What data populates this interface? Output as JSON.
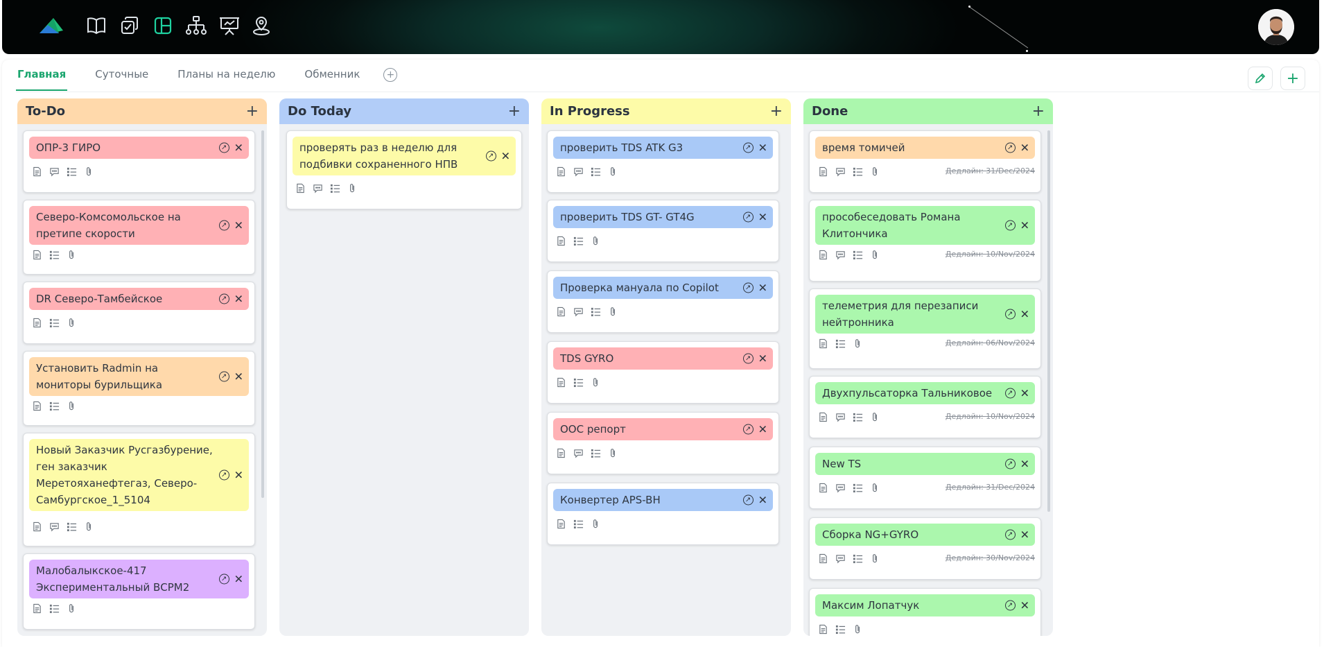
{
  "tabs": [
    "Главная",
    "Суточные",
    "Планы на неделю",
    "Обменник"
  ],
  "nav_icons": [
    "book-icon",
    "tasks-icon",
    "board-icon",
    "structure-icon",
    "presentation-icon",
    "location-icon"
  ],
  "columns": [
    {
      "title": "To-Do",
      "cards": [
        {
          "text": "ОПР-3 ГИРО",
          "color": "#ffb1b5",
          "icons": [
            "doc",
            "comment",
            "list",
            "clip"
          ]
        },
        {
          "text": "Северо-Комсомольское на претипе скорости",
          "color": "#ffb1b5",
          "icons": [
            "doc",
            "list",
            "clip"
          ]
        },
        {
          "text": "DR Северо-Тамбейское",
          "color": "#ffb1b5",
          "icons": [
            "doc",
            "list",
            "clip"
          ]
        },
        {
          "text": "Установить Radmin на мониторы бурильщика",
          "color": "#ffd9ab",
          "icons": [
            "doc",
            "list",
            "clip"
          ]
        },
        {
          "text": "Новый Заказчик Русгазбурение, ген заказчик Меретояханефтегаз, Северо-Самбургское_1_5104",
          "color": "#fdfba8",
          "icons": [
            "doc",
            "comment",
            "list",
            "clip"
          ]
        },
        {
          "text": "Малобалыкское-417 Экспериментальный ВСРМ2",
          "color": "#dcb0ff",
          "icons": [
            "doc",
            "list",
            "clip"
          ]
        }
      ]
    },
    {
      "title": "Do Today",
      "cards": [
        {
          "text": "проверять раз в неделю для подбивки сохраненного НПВ",
          "color": "#fdfba8",
          "icons": [
            "doc",
            "comment",
            "list",
            "clip"
          ]
        }
      ]
    },
    {
      "title": "In Progress",
      "cards": [
        {
          "text": "проверить TDS ATK G3",
          "color": "#a9c9f7",
          "icons": [
            "doc",
            "comment",
            "list",
            "clip"
          ]
        },
        {
          "text": "проверить TDS GT- GT4G",
          "color": "#a9c9f7",
          "icons": [
            "doc",
            "list",
            "clip"
          ]
        },
        {
          "text": "Проверка мануала по Copilot",
          "color": "#a9c9f7",
          "icons": [
            "doc",
            "comment",
            "list",
            "clip"
          ]
        },
        {
          "text": "TDS GYRO",
          "color": "#ffb1b5",
          "icons": [
            "doc",
            "list",
            "clip"
          ]
        },
        {
          "text": "OOC репорт",
          "color": "#ffb1b5",
          "icons": [
            "doc",
            "comment",
            "list",
            "clip"
          ]
        },
        {
          "text": "Конвертер APS-BH",
          "color": "#a9c9f7",
          "icons": [
            "doc",
            "list",
            "clip"
          ]
        }
      ]
    },
    {
      "title": "Done",
      "cards": [
        {
          "text": "время томичей",
          "color": "#ffd9ab",
          "icons": [
            "doc",
            "comment",
            "list",
            "clip"
          ],
          "deadline": "Дедлайн: 31/Dec/2024"
        },
        {
          "text": "прособеседовать Романа Клитончика",
          "color": "#abf7ad",
          "icons": [
            "doc",
            "comment",
            "list",
            "clip"
          ],
          "deadline": "Дедлайн: 10/Nov/2024"
        },
        {
          "text": "телеметрия для перезаписи нейтронника",
          "color": "#abf7ad",
          "icons": [
            "doc",
            "list",
            "clip"
          ],
          "deadline": "Дедлайн: 06/Nov/2024"
        },
        {
          "text": "Двухпульсаторка Тальниковое",
          "color": "#abf7ad",
          "icons": [
            "doc",
            "comment",
            "list",
            "clip"
          ],
          "deadline": "Дедлайн: 10/Nov/2024"
        },
        {
          "text": "New TS",
          "color": "#abf7ad",
          "icons": [
            "doc",
            "comment",
            "list",
            "clip"
          ],
          "deadline": "Дедлайн: 31/Dec/2024"
        },
        {
          "text": "Сборка NG+GYRO",
          "color": "#abf7ad",
          "icons": [
            "doc",
            "comment",
            "list",
            "clip"
          ],
          "deadline": "Дедлайн: 30/Nov/2024"
        },
        {
          "text": "Максим Лопатчук",
          "color": "#abf7ad",
          "icons": [
            "doc",
            "list",
            "clip"
          ]
        }
      ]
    }
  ],
  "colors": {
    "accent": "#1aa56e",
    "todo_header": "#ffd9ab",
    "today_header": "#b2cdf8",
    "progress_header": "#fdfba8",
    "done_header": "#abf7ad"
  }
}
